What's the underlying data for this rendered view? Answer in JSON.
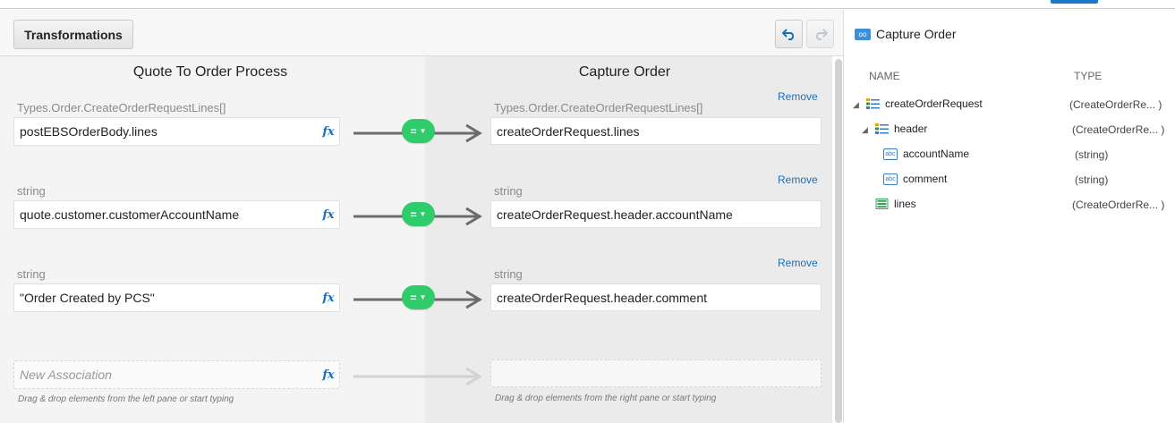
{
  "toolbar": {
    "transformations_label": "Transformations",
    "undo_icon": "undo-icon",
    "redo_icon": "redo-icon"
  },
  "mapping": {
    "source_title": "Quote To Order Process",
    "target_title": "Capture Order",
    "remove_label": "Remove",
    "fx_label": "fx",
    "operator_label": "=",
    "rows": [
      {
        "source_type": "Types.Order.CreateOrderRequestLines[]",
        "source_expr": "postEBSOrderBody.lines",
        "target_type": "Types.Order.CreateOrderRequestLines[]",
        "target_expr": "createOrderRequest.lines"
      },
      {
        "source_type": "string",
        "source_expr": "quote.customer.customerAccountName",
        "target_type": "string",
        "target_expr": "createOrderRequest.header.accountName"
      },
      {
        "source_type": "string",
        "source_expr": "\"Order Created by PCS\"",
        "target_type": "string",
        "target_expr": "createOrderRequest.header.comment"
      }
    ],
    "new_association": {
      "placeholder": "New Association",
      "source_hint": "Drag & drop elements from the left pane or start typing",
      "target_hint": "Drag & drop elements from the right pane or start typing"
    }
  },
  "tree_panel": {
    "title": "Capture Order",
    "col_name": "NAME",
    "col_type": "TYPE",
    "nodes": [
      {
        "name": "createOrderRequest",
        "type": "(CreateOrderRe... )",
        "icon": "object-icon"
      },
      {
        "name": "header",
        "type": "(CreateOrderRe... )",
        "icon": "object-icon"
      },
      {
        "name": "accountName",
        "type": "(string)",
        "icon": "string-icon",
        "icon_text": "abc"
      },
      {
        "name": "comment",
        "type": "(string)",
        "icon": "string-icon",
        "icon_text": "abc"
      },
      {
        "name": "lines",
        "type": "(CreateOrderRe... )",
        "icon": "array-icon"
      }
    ]
  },
  "colors": {
    "accent": "#1b6fb8",
    "operator_pill": "#2ecc6b",
    "left_pane_bg": "#f4f4f4",
    "right_pane_bg": "#ebebeb"
  }
}
